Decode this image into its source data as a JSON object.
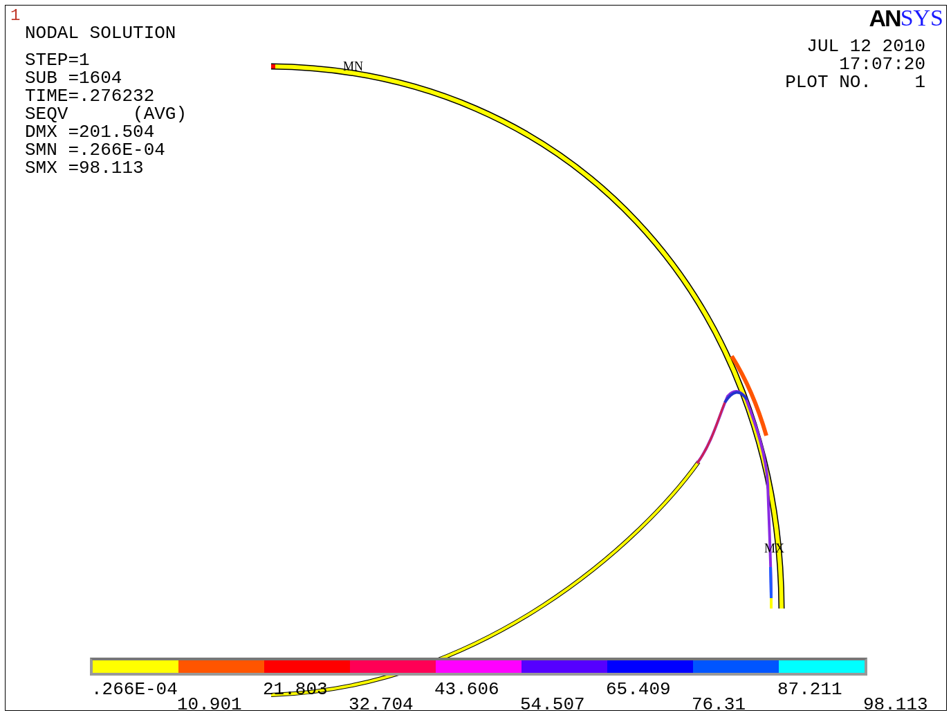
{
  "window_number": "1",
  "title": "NODAL SOLUTION",
  "info_lines": [
    "STEP=1",
    "SUB =1604",
    "TIME=.276232",
    "SEQV      (AVG)",
    "DMX =201.504",
    "SMN =.266E-04",
    "SMX =98.113"
  ],
  "logo": {
    "part_1": "AN",
    "part_2": "SYS"
  },
  "date": "JUL 12 2010",
  "time": "17:07:20",
  "plot_number": "PLOT NO.    1",
  "markers": [
    {
      "kind": "min",
      "label": "MN"
    },
    {
      "kind": "max",
      "label": "MX"
    }
  ],
  "legend": {
    "bands": [
      {
        "color": "#ffff00"
      },
      {
        "color": "#ff5500"
      },
      {
        "color": "#ff0000"
      },
      {
        "color": "#ff0055"
      },
      {
        "color": "#ff00ff"
      },
      {
        "color": "#5500ff"
      },
      {
        "color": "#0000ff"
      },
      {
        "color": "#0055ff"
      },
      {
        "color": "#00ffff"
      }
    ],
    "labels": [
      ".266E-04",
      "10.901",
      "21.803",
      "32.704",
      "43.606",
      "54.507",
      "65.409",
      "76.31",
      "87.211",
      "98.113"
    ]
  }
}
